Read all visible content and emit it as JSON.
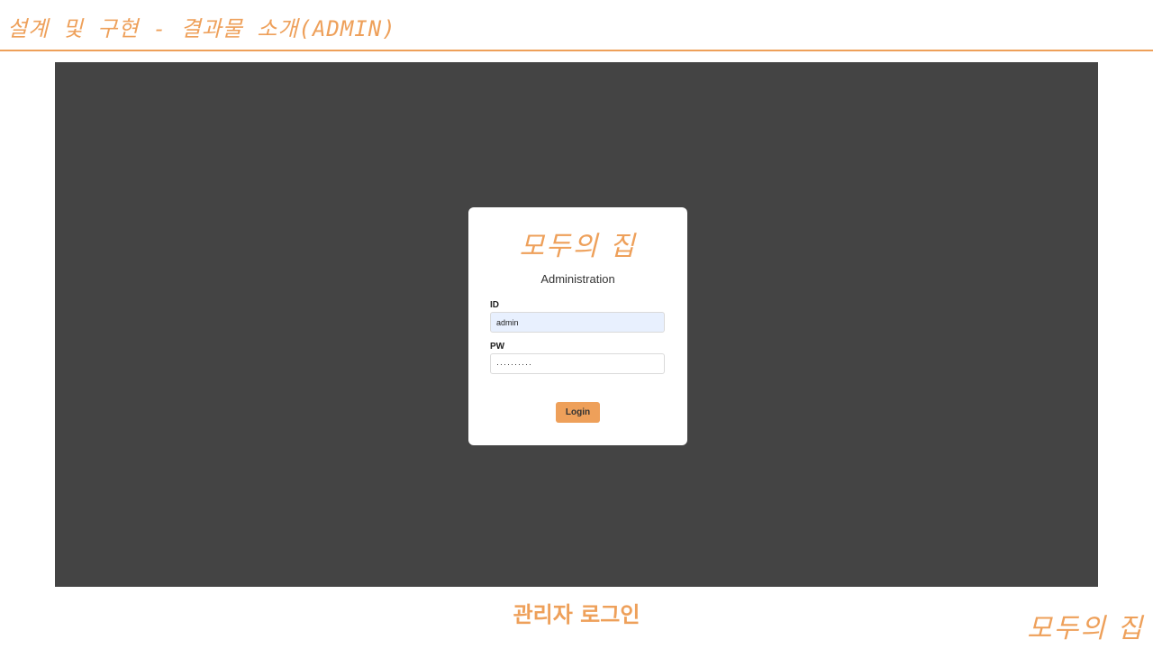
{
  "slide": {
    "title": "설계 및 구현 - 결과물 소개(ADMIN)",
    "caption": "관리자 로그인",
    "corner_logo": "모두의 집"
  },
  "login": {
    "brand": "모두의 집",
    "subtitle": "Administration",
    "id_label": "ID",
    "id_value": "admin",
    "pw_label": "PW",
    "pw_value": "··········",
    "login_label": "Login"
  },
  "colors": {
    "accent": "#eea05a",
    "backdrop": "#444444",
    "id_field_bg": "#e8f0fe"
  }
}
